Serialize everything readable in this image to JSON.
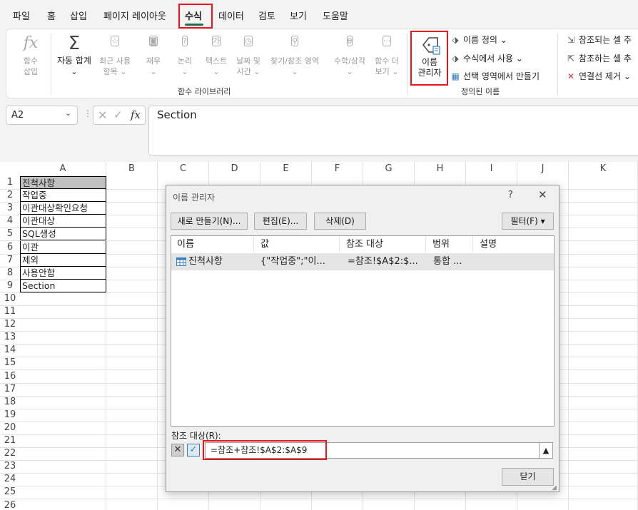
{
  "menu": {
    "tabs": [
      "파일",
      "홈",
      "삽입",
      "페이지 레이아웃",
      "수식",
      "데이터",
      "검토",
      "보기",
      "도움말"
    ],
    "active_tab": "수식"
  },
  "ribbon": {
    "library": {
      "insert_function": {
        "line1": "함수",
        "line2": "삽입"
      },
      "autosum": {
        "line1": "자동 합계",
        "line2": "⌄"
      },
      "recent": {
        "line1": "최근 사용",
        "line2": "항목 ⌄"
      },
      "financial": {
        "line1": "재무",
        "line2": "⌄"
      },
      "logical": {
        "line1": "논리",
        "line2": "⌄"
      },
      "text": {
        "line1": "텍스트",
        "line2": "⌄"
      },
      "datetime": {
        "line1": "날짜 및",
        "line2": "시간 ⌄"
      },
      "lookup": {
        "line1": "찾기/참조 영역",
        "line2": "⌄"
      },
      "math": {
        "line1": "수학/삼각",
        "line2": "⌄"
      },
      "more": {
        "line1": "함수 더",
        "line2": "보기 ⌄"
      },
      "group_label": "함수 라이브러리"
    },
    "defined_names": {
      "name_manager": {
        "line1": "이름",
        "line2": "관리자"
      },
      "define_name": "이름 정의  ⌄",
      "use_in_formula": "수식에서 사용 ⌄",
      "create_from_selection": "선택 영역에서 만들기",
      "group_label": "정의된 이름"
    },
    "auditing": {
      "trace_precedents": "참조되는 셀 추",
      "trace_dependents": "참조하는 셀 추",
      "remove_arrows": "연결선 제거  ⌄"
    }
  },
  "formula_bar": {
    "name_box": "A2",
    "fx": "fx",
    "content": "Section"
  },
  "grid": {
    "columns": [
      "A",
      "B",
      "C",
      "D",
      "E",
      "F",
      "G",
      "H",
      "I",
      "J",
      "K"
    ],
    "rows": [
      "1",
      "2",
      "3",
      "4",
      "5",
      "6",
      "7",
      "8",
      "9",
      "10",
      "11",
      "12",
      "13",
      "14",
      "15",
      "16",
      "17",
      "18",
      "19",
      "20",
      "21",
      "22",
      "23",
      "24",
      "25",
      "26"
    ],
    "cells_a": [
      "진척사항",
      "작업중",
      "이관대상확인요청",
      "이관대상",
      "SQL생성",
      "이관",
      "제외",
      "사용안함",
      "Section"
    ]
  },
  "dialog": {
    "title": "이름 관리자",
    "help": "?",
    "close": "✕",
    "buttons": {
      "new": "새로 만들기(N)...",
      "edit": "편집(E)...",
      "delete": "삭제(D)",
      "filter": "필터(F) ▾"
    },
    "list_headers": [
      "이름",
      "값",
      "참조 대상",
      "범위",
      "설명"
    ],
    "list_rows": [
      {
        "name": "진척사항",
        "value": "{\"작업중\";\"이...",
        "refers_to": "=참조!$A$2:$...",
        "scope": "통합 ...",
        "comment": ""
      }
    ],
    "refers_to_label": "참조 대상(R):",
    "refers_to_value": "=참조+참조!$A$2:$A$9",
    "close_button": "닫기"
  },
  "colors": {
    "accent": "#1e7145",
    "highlight_box": "#e8141b",
    "header_cell_fill": "#c0c0c0"
  }
}
